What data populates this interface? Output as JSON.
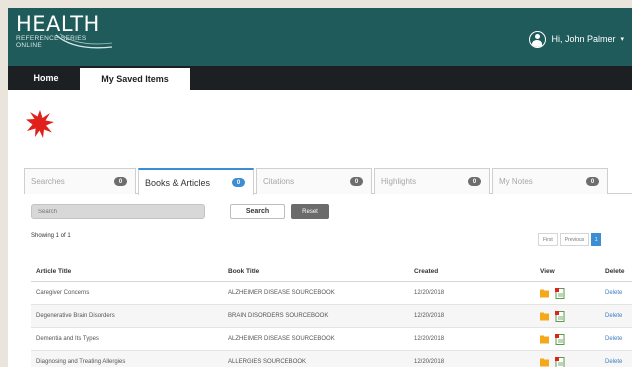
{
  "header": {
    "logo_main": "HEALTH",
    "logo_line1": "REFERENCE SERIES",
    "logo_line2": "ONLINE",
    "user_greeting": "Hi, John Palmer"
  },
  "nav": {
    "home": "Home",
    "saved": "My Saved Items"
  },
  "tabs": [
    {
      "label": "Searches",
      "count": "0"
    },
    {
      "label": "Books & Articles",
      "count": "0"
    },
    {
      "label": "Citations",
      "count": "0"
    },
    {
      "label": "Highlights",
      "count": "0"
    },
    {
      "label": "My Notes",
      "count": "0"
    }
  ],
  "search": {
    "placeholder": "Search",
    "search_button": "Search",
    "reset_button": "Reset"
  },
  "showing": "Showing 1 of 1",
  "pager": {
    "first": "First",
    "previous": "Previous",
    "current": "1"
  },
  "table": {
    "headers": {
      "article": "Article Title",
      "book": "Book Title",
      "created": "Created",
      "view": "View",
      "delete": "Delete"
    },
    "rows": [
      {
        "article": "Caregiver Concerns",
        "book": "ALZHEIMER DISEASE SOURCEBOOK",
        "created": "12/20/2018",
        "delete": "Delete"
      },
      {
        "article": "Degenerative Brain Disorders",
        "book": "BRAIN DISORDERS SOURCEBOOK",
        "created": "12/20/2018",
        "delete": "Delete"
      },
      {
        "article": "Dementia and Its Types",
        "book": "ALZHEIMER DISEASE SOURCEBOOK",
        "created": "12/20/2018",
        "delete": "Delete"
      },
      {
        "article": "Diagnosing and Treating Allergies",
        "book": "ALLERGIES SOURCEBOOK",
        "created": "12/20/2018",
        "delete": "Delete"
      }
    ]
  },
  "colors": {
    "header_bg": "#1e5b5a",
    "nav_bg": "#1c2023",
    "accent": "#3c8dd1",
    "star": "#e0201b"
  },
  "icons": {
    "user": "user-circle-icon",
    "star": "starburst-icon",
    "view_folder": "folder-icon",
    "view_book": "book-icon"
  }
}
